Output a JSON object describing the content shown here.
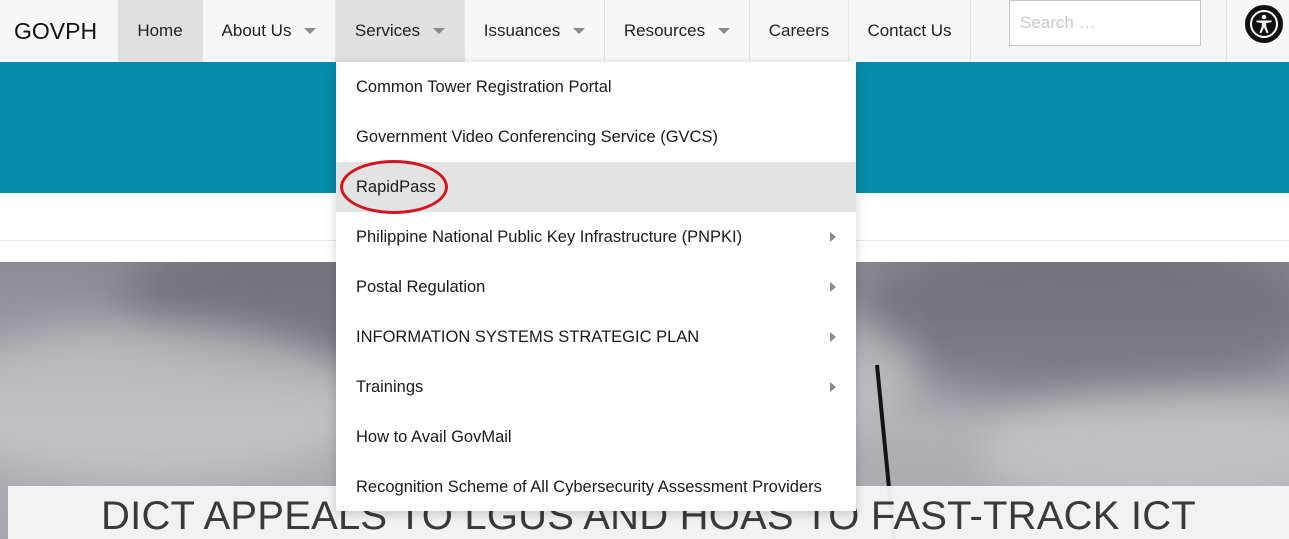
{
  "brand": "GOVPH",
  "nav": {
    "home": "Home",
    "about": "About Us",
    "services": "Services",
    "issuances": "Issuances",
    "resources": "Resources",
    "careers": "Careers",
    "contact": "Contact Us"
  },
  "search": {
    "placeholder": "Search …",
    "value": ""
  },
  "services_menu": {
    "items": [
      {
        "label": "Common Tower Registration Portal",
        "has_submenu": false
      },
      {
        "label": "Government Video Conferencing Service (GVCS)",
        "has_submenu": false
      },
      {
        "label": "RapidPass",
        "has_submenu": false,
        "hovered": true,
        "annotated": true
      },
      {
        "label": "Philippine National Public Key Infrastructure (PNPKI)",
        "has_submenu": true
      },
      {
        "label": "Postal Regulation",
        "has_submenu": true
      },
      {
        "label": "INFORMATION SYSTEMS STRATEGIC PLAN",
        "has_submenu": true
      },
      {
        "label": "Trainings",
        "has_submenu": true
      },
      {
        "label": "How to Avail GovMail",
        "has_submenu": false
      },
      {
        "label": "Recognition Scheme of All Cybersecurity Assessment Providers",
        "has_submenu": false
      }
    ]
  },
  "hero": {
    "headline": "DICT APPEALS TO LGUS AND HOAS TO FAST-TRACK ICT"
  },
  "icons": {
    "caret": "chevron-down-icon",
    "submenu": "chevron-right-icon",
    "accessibility": "accessibility-icon"
  },
  "colors": {
    "banner": "#068ba9",
    "nav_bg": "#f7f7f7",
    "nav_active": "#e0e0e0",
    "menu_hover": "#e3e3e3",
    "annotation": "#d3161f"
  }
}
